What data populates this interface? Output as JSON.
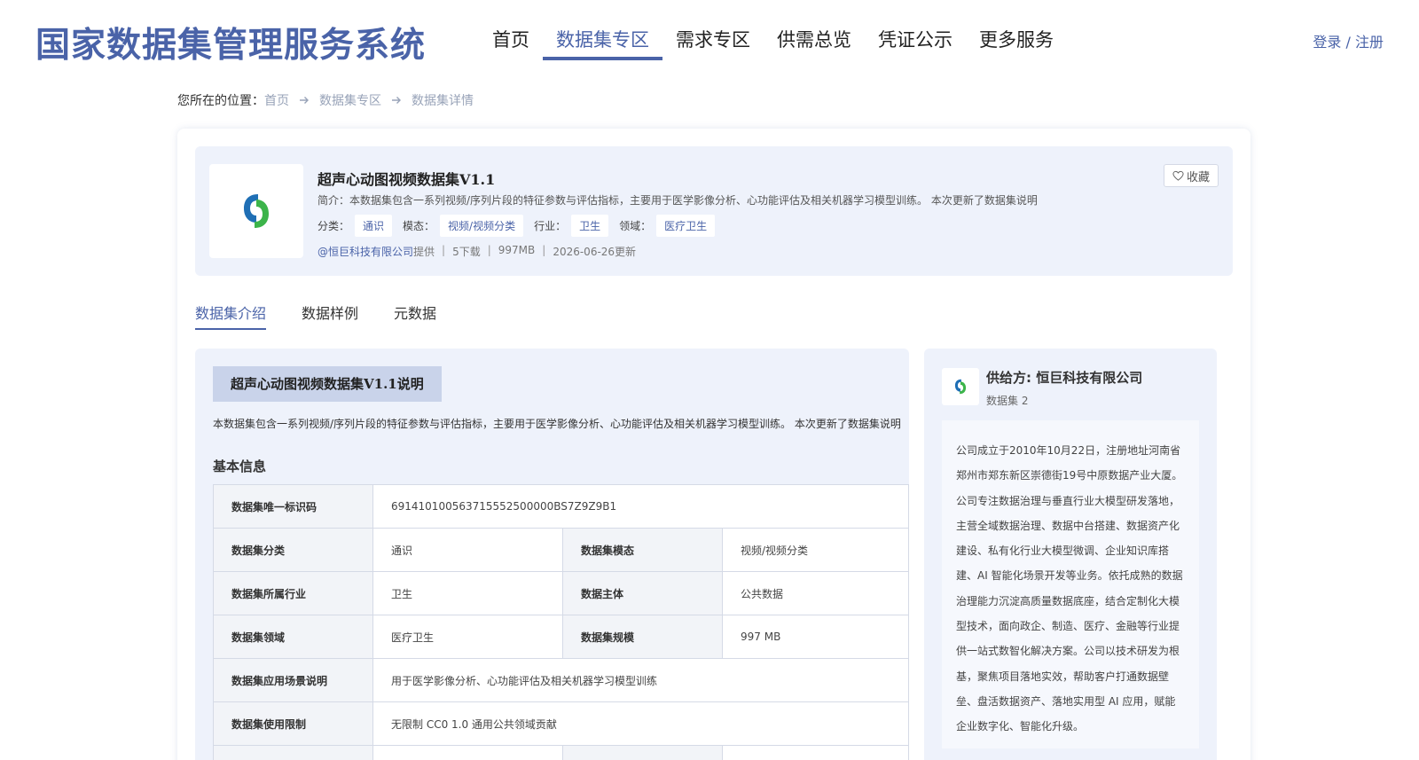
{
  "header": {
    "logo": "国家数据集管理服务系统",
    "nav": [
      {
        "label": "首页",
        "active": false
      },
      {
        "label": "数据集专区",
        "active": true
      },
      {
        "label": "需求专区",
        "active": false
      },
      {
        "label": "供需总览",
        "active": false
      },
      {
        "label": "凭证公示",
        "active": false
      },
      {
        "label": "更多服务",
        "active": false
      }
    ],
    "login": "登录 / 注册"
  },
  "breadcrumb": {
    "label": "您所在的位置：",
    "items": [
      "首页",
      "数据集专区",
      "数据集详情"
    ]
  },
  "dataset": {
    "title": "超声心动图视频数据集V1.1",
    "intro": "简介：本数据集包含一系列视频/序列片段的特征参数与评估指标，主要用于医学影像分析、心功能评估及相关机器学习模型训练。 本次更新了数据集说明",
    "tags": [
      {
        "label": "分类：",
        "value": "通识"
      },
      {
        "label": "模态：",
        "value": "视频/视频分类"
      },
      {
        "label": "行业：",
        "value": "卫生"
      },
      {
        "label": "领域：",
        "value": "医疗卫生"
      }
    ],
    "provider": "@恒巨科技有限公司",
    "provided_suffix": "提供",
    "downloads": "5下载",
    "size": "997MB",
    "updated": "2026-06-26更新",
    "favorite": "收藏"
  },
  "tabs": [
    "数据集介绍",
    "数据样例",
    "元数据"
  ],
  "content": {
    "desc_title": "超声心动图视频数据集V1.1说明",
    "desc_text": "本数据集包含一系列视频/序列片段的特征参数与评估指标，主要用于医学影像分析、心功能评估及相关机器学习模型训练。 本次更新了数据集说明",
    "basic_title": "基本信息",
    "table": {
      "id_key": "数据集唯一标识码",
      "id_val": "691410100563715552500000BS7Z9Z9B1",
      "cat_key": "数据集分类",
      "cat_val": "通识",
      "mod_key": "数据集模态",
      "mod_val": "视频/视频分类",
      "ind_key": "数据集所属行业",
      "ind_val": "卫生",
      "subj_key": "数据主体",
      "subj_val": "公共数据",
      "field_key": "数据集领域",
      "field_val": "医疗卫生",
      "scale_key": "数据集规模",
      "scale_val": "997 MB",
      "scene_key": "数据集应用场景说明",
      "scene_val": "用于医学影像分析、心功能评估及相关机器学习模型训练",
      "limit_key": "数据集使用限制",
      "limit_val": "无限制 CC0 1.0 通用公共领域贡献"
    }
  },
  "provider_panel": {
    "name": "供给方: 恒巨科技有限公司",
    "count": "数据集 2",
    "desc": "公司成立于2010年10月22日，注册地址河南省郑州市郑东新区崇德街19号中原数据产业大厦。公司专注数据治理与垂直行业大模型研发落地，主营全域数据治理、数据中台搭建、数据资产化建设、私有化行业大模型微调、企业知识库搭建、AI 智能化场景开发等业务。依托成熟的数据治理能力沉淀高质量数据底座，结合定制化大模型技术，面向政企、制造、医疗、金融等行业提供一站式数智化解决方案。公司以技术研发为根基，聚焦项目落地实效，帮助客户打通数据壁垒、盘活数据资产、落地实用型 AI 应用，赋能企业数字化、智能化升级。"
  },
  "colors": {
    "accent": "#4a63a8",
    "panel_bg": "#eef2fb",
    "logo_blue": "#1f6fb5",
    "logo_green": "#3cb44a"
  }
}
